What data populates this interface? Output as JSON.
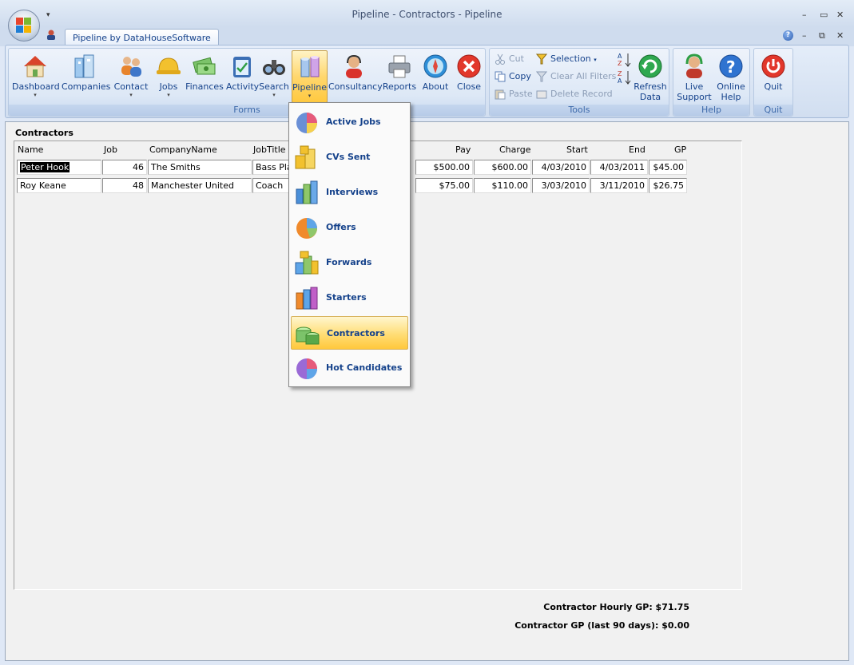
{
  "window": {
    "title": "Pipeline - Contractors - Pipeline"
  },
  "ribbon_tab": "Pipeline by DataHouseSoftware",
  "groups": {
    "forms": "Forms",
    "tools": "Tools",
    "help": "Help",
    "quit": "Quit"
  },
  "forms_buttons": [
    {
      "label": "Dashboard",
      "icon": "house-icon"
    },
    {
      "label": "Companies",
      "icon": "buildings-icon"
    },
    {
      "label": "Contact",
      "icon": "people-icon"
    },
    {
      "label": "Jobs",
      "icon": "hardhat-icon"
    },
    {
      "label": "Finances",
      "icon": "money-icon"
    },
    {
      "label": "Activity",
      "icon": "clipboard-icon"
    },
    {
      "label": "Search",
      "icon": "binoculars-icon"
    },
    {
      "label": "Pipeline",
      "icon": "cylinders-icon"
    },
    {
      "label": "Consultancy",
      "icon": "headset-person-icon"
    },
    {
      "label": "Reports",
      "icon": "printer-icon"
    },
    {
      "label": "About",
      "icon": "compass-icon"
    },
    {
      "label": "Close",
      "icon": "close-circle-icon"
    }
  ],
  "tools": {
    "cut": "Cut",
    "copy": "Copy",
    "paste": "Paste",
    "selection": "Selection",
    "clear_filters": "Clear All Filters",
    "delete_record": "Delete Record",
    "refresh_line1": "Refresh",
    "refresh_line2": "Data"
  },
  "help": {
    "live_line1": "Live",
    "live_line2": "Support",
    "online_line1": "Online",
    "online_line2": "Help"
  },
  "quit": {
    "label": "Quit"
  },
  "form": {
    "title": "Contractors",
    "columns": {
      "name": "Name",
      "job": "Job",
      "company": "CompanyName",
      "jobtitle": "JobTitle",
      "pay": "Pay",
      "charge": "Charge",
      "start": "Start",
      "end": "End",
      "gp": "GP"
    },
    "rows": [
      {
        "name": "Peter Hook",
        "job": "46",
        "company": "The Smiths",
        "jobtitle": "Bass Play",
        "pay": "$500.00",
        "charge": "$600.00",
        "start": "4/03/2010",
        "end": "4/03/2011",
        "gp": "$45.00"
      },
      {
        "name": "Roy Keane",
        "job": "48",
        "company": "Manchester United",
        "jobtitle": "Coach",
        "pay": "$75.00",
        "charge": "$110.00",
        "start": "3/03/2010",
        "end": "3/11/2010",
        "gp": "$26.75"
      }
    ],
    "hourly_gp": "Contractor Hourly GP: $71.75",
    "gp_90": "Contractor GP (last 90 days): $0.00"
  },
  "pipeline_menu": [
    {
      "label": "Active Jobs",
      "icon": "pie-chart-icon"
    },
    {
      "label": "CVs Sent",
      "icon": "yellow-boxes-icon"
    },
    {
      "label": "Interviews",
      "icon": "bar-chart-icon"
    },
    {
      "label": "Offers",
      "icon": "pie-chart-orange-icon"
    },
    {
      "label": "Forwards",
      "icon": "blocks-icon"
    },
    {
      "label": "Starters",
      "icon": "cylinders-colored-icon"
    },
    {
      "label": "Contractors",
      "icon": "green-cylinders-icon"
    },
    {
      "label": "Hot Candidates",
      "icon": "pie-chart-purple-icon"
    }
  ],
  "colors": {
    "accent": "#15428b",
    "highlight": "#ffd76e"
  }
}
